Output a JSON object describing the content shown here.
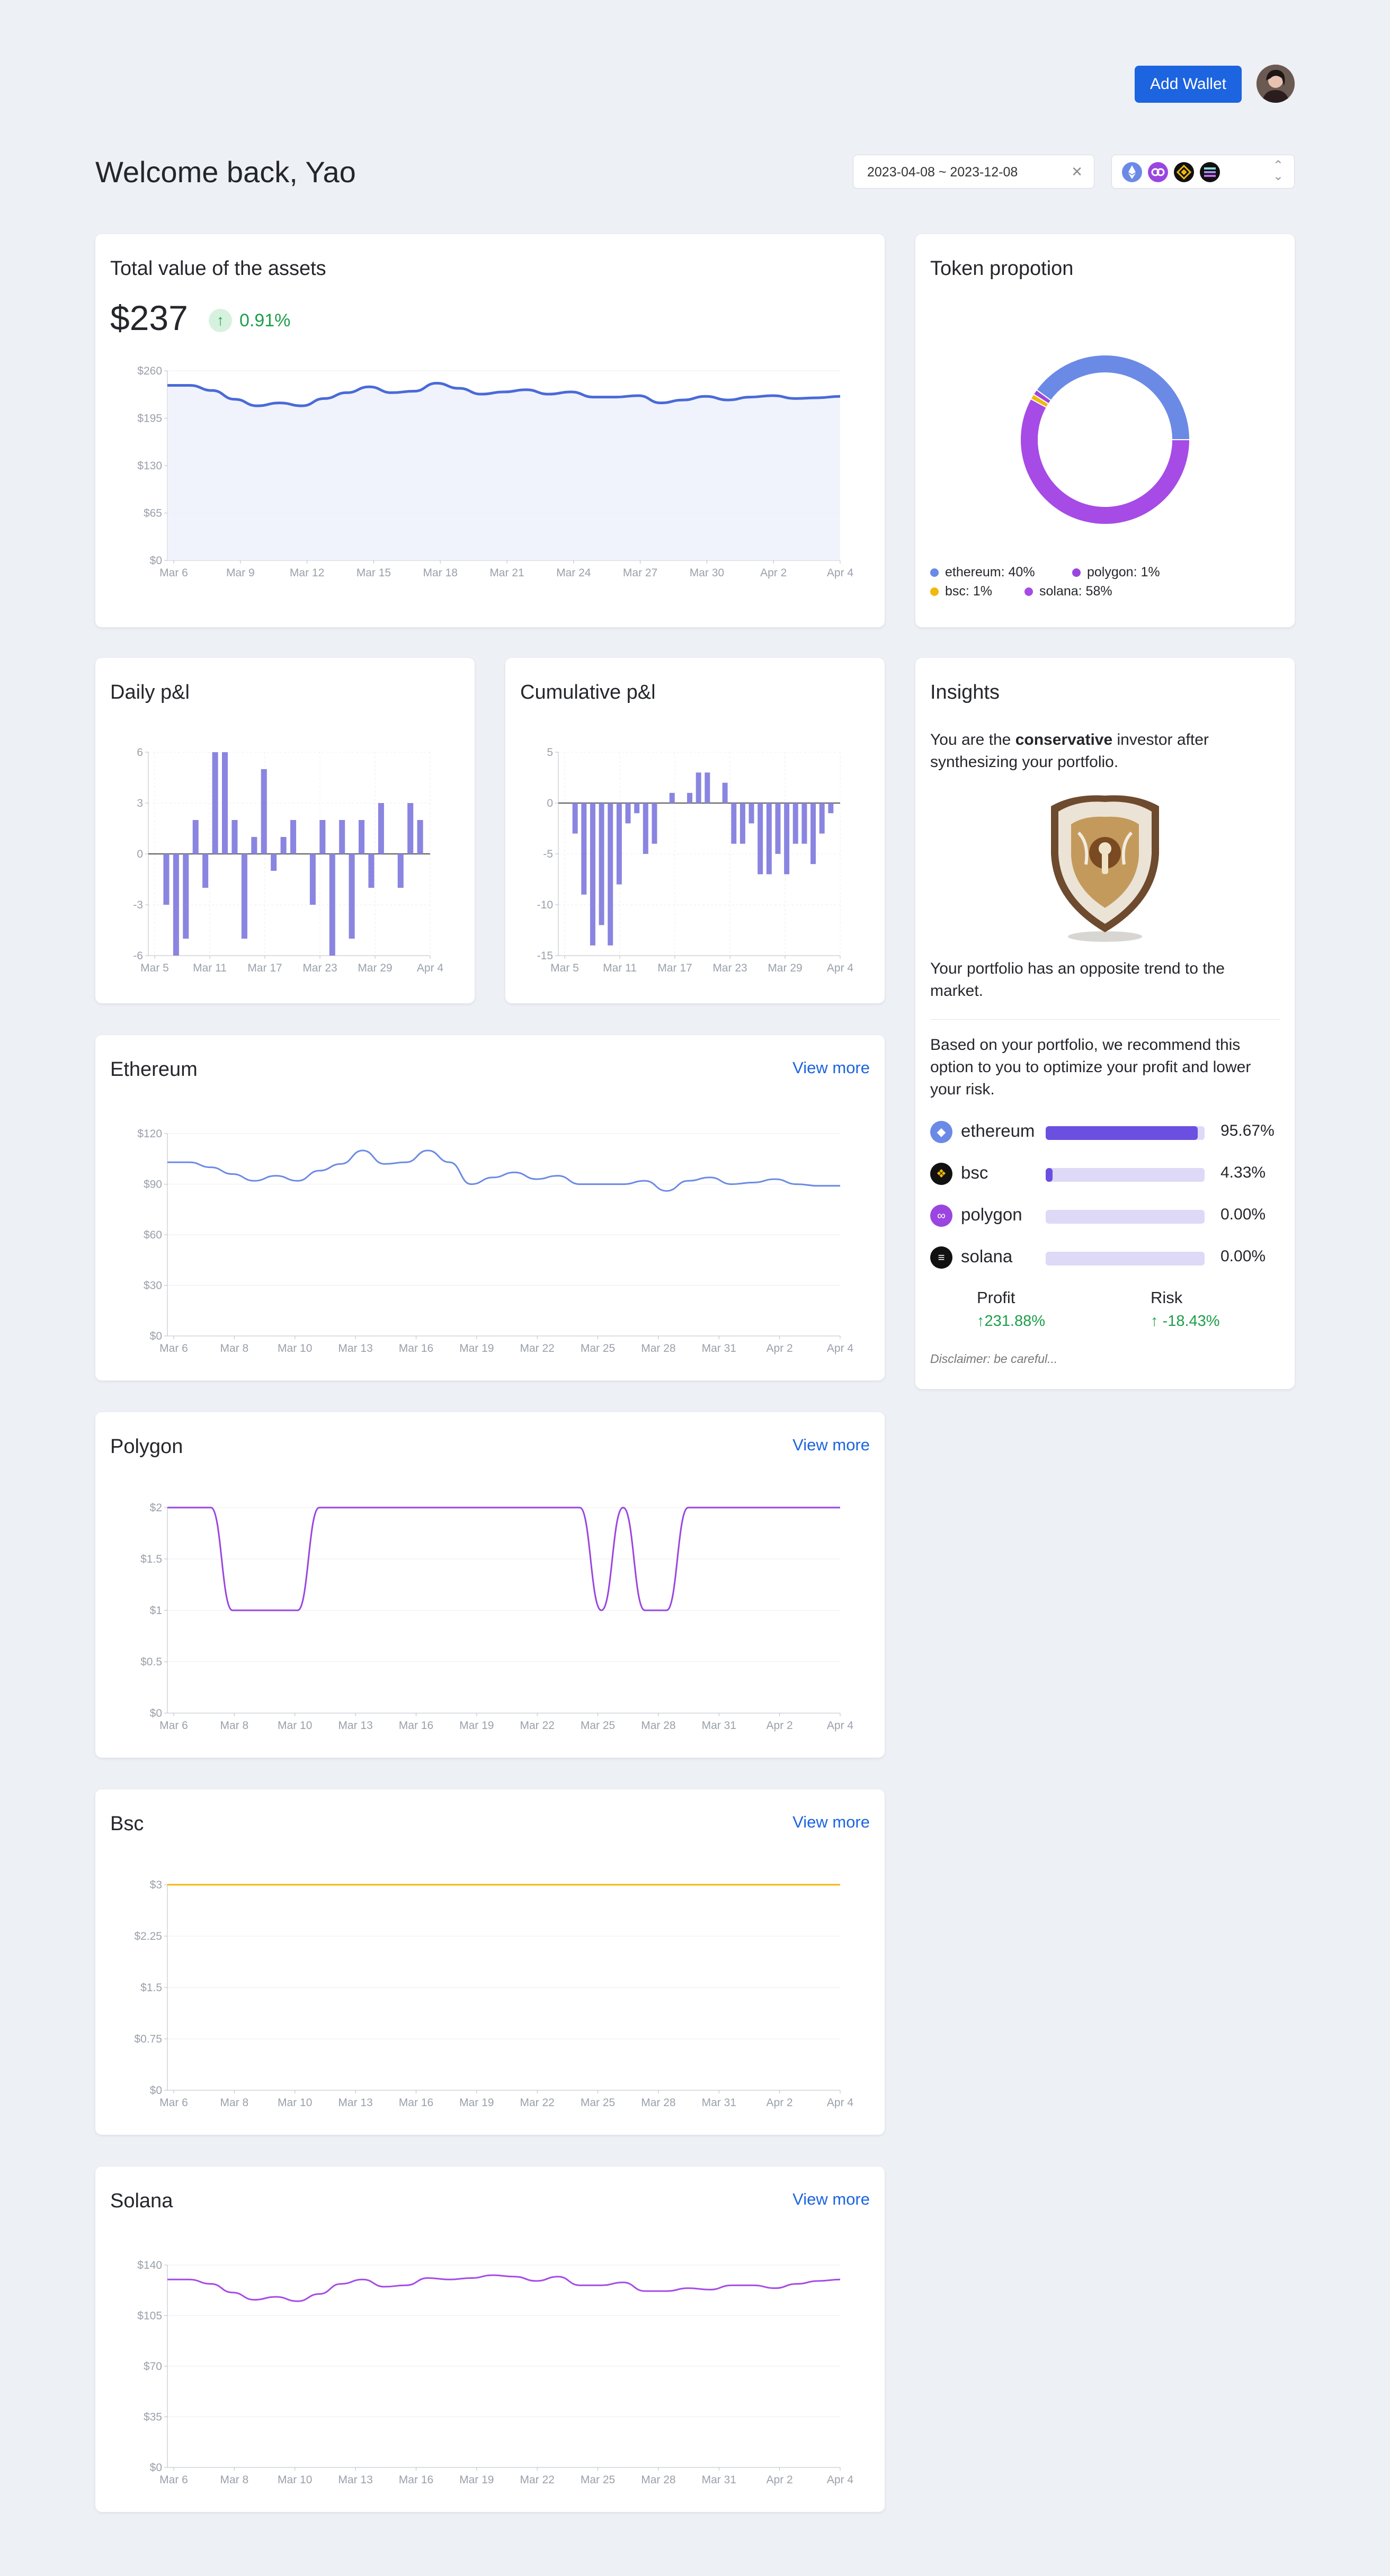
{
  "header": {
    "add_wallet": "Add Wallet",
    "greeting": "Welcome back, Yao"
  },
  "filters": {
    "date_range": "2023-04-08 ~ 2023-12-08",
    "tokens": [
      "ethereum-icon",
      "polygon-icon",
      "bsc-icon",
      "solana-icon"
    ]
  },
  "colors": {
    "primary": "#1c64e0",
    "line": "#4a6ad8",
    "bars": "#8a85e0",
    "ethereum": "#6b8ae6",
    "polygon": "#9a45e0",
    "bsc": "#f0b90b",
    "solana": "#a64be6",
    "positive": "#1e9e4a"
  },
  "total_value": {
    "title": "Total value of the assets",
    "amount": "$237",
    "change": "0.91%"
  },
  "token_proportion": {
    "title": "Token propotion",
    "legend": [
      {
        "label": "ethereum: 40%",
        "color": "#6b8ae6"
      },
      {
        "label": "polygon: 1%",
        "color": "#9a45e0"
      },
      {
        "label": "bsc: 1%",
        "color": "#f0b90b"
      },
      {
        "label": "solana: 58%",
        "color": "#a64be6"
      }
    ]
  },
  "daily_pl": {
    "title": "Daily p&l"
  },
  "cumulative_pl": {
    "title": "Cumulative p&l"
  },
  "insights": {
    "title": "Insights",
    "p1_pre": "You are the ",
    "p1_bold": "conservative",
    "p1_post": " investor after synthesizing your portfolio.",
    "p2": "Your portfolio has an opposite trend to the market.",
    "p3": "Based on your portfolio, we recommend this option to you to optimize your profit and lower your risk.",
    "recommendations": [
      {
        "name": "ethereum",
        "value": "95.67%",
        "fraction": 0.9567,
        "icon": "ethereum-icon"
      },
      {
        "name": "bsc",
        "value": "4.33%",
        "fraction": 0.0433,
        "icon": "bsc-icon"
      },
      {
        "name": "polygon",
        "value": "0.00%",
        "fraction": 0,
        "icon": "polygon-icon"
      },
      {
        "name": "solana",
        "value": "0.00%",
        "fraction": 0,
        "icon": "solana-icon"
      }
    ],
    "profit_label": "Profit",
    "profit_value": "↑231.88%",
    "risk_label": "Risk",
    "risk_value": "↑ -18.43%",
    "disclaimer": "Disclaimer: be careful..."
  },
  "token_cards": [
    {
      "title": "Ethereum",
      "view_more": "View more"
    },
    {
      "title": "Polygon",
      "view_more": "View more"
    },
    {
      "title": "Bsc",
      "view_more": "View more"
    },
    {
      "title": "Solana",
      "view_more": "View more"
    }
  ],
  "chart_data": [
    {
      "type": "area",
      "name": "total-value",
      "x": [
        "Mar 6",
        "Mar 9",
        "Mar 12",
        "Mar 15",
        "Mar 18",
        "Mar 21",
        "Mar 24",
        "Mar 27",
        "Mar 30",
        "Apr 2",
        "Apr 4"
      ],
      "yticks": [
        "$0",
        "$65",
        "$130",
        "$195",
        "$260"
      ],
      "ylim": [
        0,
        260
      ],
      "values": [
        240,
        240,
        233,
        221,
        212,
        216,
        212,
        222,
        230,
        238,
        230,
        232,
        243,
        236,
        228,
        231,
        234,
        228,
        231,
        224,
        224,
        226,
        216,
        220,
        225,
        220,
        224,
        226,
        222,
        223,
        225
      ]
    },
    {
      "type": "pie",
      "name": "token-proportion",
      "labels": [
        "ethereum",
        "polygon",
        "bsc",
        "solana"
      ],
      "values": [
        40,
        1,
        1,
        58
      ]
    },
    {
      "type": "bar",
      "name": "daily-pl",
      "x": [
        "Mar 5",
        "Mar 11",
        "Mar 17",
        "Mar 23",
        "Mar 29",
        "Apr 4"
      ],
      "yticks": [
        "6",
        "3",
        "0",
        "-3",
        "-6"
      ],
      "ylim": [
        -6,
        6
      ],
      "values": [
        0,
        -3,
        -6,
        -5,
        2,
        -2,
        6,
        6,
        2,
        -5,
        1,
        5,
        -1,
        1,
        2,
        0,
        -3,
        2,
        -6,
        2,
        -5,
        2,
        -2,
        3,
        0,
        -2,
        3,
        2
      ]
    },
    {
      "type": "bar",
      "name": "cumulative-pl",
      "x": [
        "Mar 5",
        "Mar 11",
        "Mar 17",
        "Mar 23",
        "Mar 29",
        "Apr 4"
      ],
      "yticks": [
        "5",
        "0",
        "-5",
        "-10",
        "-15"
      ],
      "ylim": [
        -15,
        5
      ],
      "values": [
        0,
        -3,
        -9,
        -14,
        -12,
        -14,
        -8,
        -2,
        -1,
        -5,
        -4,
        0,
        1,
        0,
        1,
        3,
        3,
        0,
        2,
        -4,
        -4,
        -2,
        -7,
        -7,
        -5,
        -7,
        -4,
        -4,
        -6,
        -3,
        -1
      ]
    },
    {
      "type": "line",
      "name": "ethereum-price",
      "x": [
        "Mar 6",
        "Mar 8",
        "Mar 10",
        "Mar 13",
        "Mar 16",
        "Mar 19",
        "Mar 22",
        "Mar 25",
        "Mar 28",
        "Mar 31",
        "Apr 2",
        "Apr 4"
      ],
      "yticks": [
        "$0",
        "$30",
        "$60",
        "$90",
        "$120"
      ],
      "ylim": [
        0,
        120
      ],
      "values": [
        103,
        103,
        100,
        96,
        92,
        95,
        92,
        98,
        102,
        110,
        102,
        103,
        110,
        103,
        90,
        94,
        97,
        93,
        95,
        90,
        90,
        90,
        92,
        86,
        92,
        94,
        90,
        91,
        93,
        90,
        89,
        89
      ]
    },
    {
      "type": "line",
      "name": "polygon-price",
      "x": [
        "Mar 6",
        "Mar 8",
        "Mar 10",
        "Mar 13",
        "Mar 16",
        "Mar 19",
        "Mar 22",
        "Mar 25",
        "Mar 28",
        "Mar 31",
        "Apr 2",
        "Apr 4"
      ],
      "yticks": [
        "$0",
        "$0.5",
        "$1",
        "$1.5",
        "$2"
      ],
      "ylim": [
        0,
        2
      ],
      "values": [
        2,
        2,
        2,
        1,
        1,
        1,
        1,
        2,
        2,
        2,
        2,
        2,
        2,
        2,
        2,
        2,
        2,
        2,
        2,
        2,
        1,
        2,
        1,
        1,
        2,
        2,
        2,
        2,
        2,
        2,
        2,
        2
      ]
    },
    {
      "type": "line",
      "name": "bsc-price",
      "x": [
        "Mar 6",
        "Mar 8",
        "Mar 10",
        "Mar 13",
        "Mar 16",
        "Mar 19",
        "Mar 22",
        "Mar 25",
        "Mar 28",
        "Mar 31",
        "Apr 2",
        "Apr 4"
      ],
      "yticks": [
        "$0",
        "$0.75",
        "$1.5",
        "$2.25",
        "$3"
      ],
      "ylim": [
        0,
        3
      ],
      "values": [
        3,
        3,
        3,
        3,
        3,
        3,
        3,
        3,
        3,
        3,
        3,
        3,
        3,
        3,
        3,
        3,
        3,
        3,
        3,
        3,
        3,
        3,
        3,
        3,
        3,
        3,
        3,
        3,
        3,
        3,
        3,
        3
      ]
    },
    {
      "type": "line",
      "name": "solana-price",
      "x": [
        "Mar 6",
        "Mar 8",
        "Mar 10",
        "Mar 13",
        "Mar 16",
        "Mar 19",
        "Mar 22",
        "Mar 25",
        "Mar 28",
        "Mar 31",
        "Apr 2",
        "Apr 4"
      ],
      "yticks": [
        "$0",
        "$35",
        "$70",
        "$105",
        "$140"
      ],
      "ylim": [
        0,
        140
      ],
      "values": [
        130,
        130,
        127,
        121,
        116,
        118,
        115,
        120,
        127,
        130,
        125,
        126,
        131,
        130,
        131,
        133,
        132,
        129,
        132,
        126,
        126,
        128,
        122,
        122,
        124,
        123,
        126,
        126,
        124,
        127,
        129,
        130
      ]
    }
  ]
}
